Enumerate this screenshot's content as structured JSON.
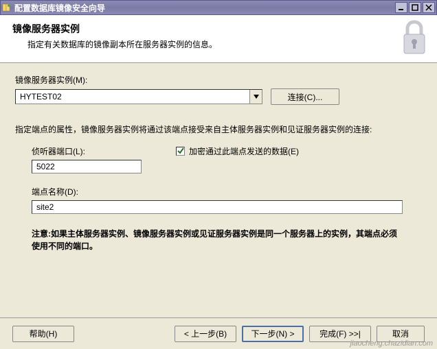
{
  "titlebar": {
    "title": "配置数据库镜像安全向导"
  },
  "header": {
    "title": "镜像服务器实例",
    "subtitle": "指定有关数据库的镜像副本所在服务器实例的信息。"
  },
  "mirror_server": {
    "label": "镜像服务器实例(M):",
    "value": "HYTEST02",
    "connect_button": "连接(C)..."
  },
  "endpoint_desc": "指定端点的属性，镜像服务器实例将通过该端点接受来自主体服务器实例和见证服务器实例的连接:",
  "listener_port": {
    "label": "侦听器端口(L):",
    "value": "5022"
  },
  "encrypt": {
    "checked": true,
    "label": "加密通过此端点发送的数据(E)"
  },
  "endpoint_name": {
    "label": "端点名称(D):",
    "value": "site2"
  },
  "warning": "注意:如果主体服务器实例、镜像服务器实例或见证服务器实例是同一个服务器上的实例，其端点必须使用不同的端口。",
  "buttons": {
    "help": "帮助(H)",
    "back": "< 上一步(B)",
    "next": "下一步(N) >",
    "finish": "完成(F) >>|",
    "cancel": "取消"
  },
  "watermark": "jiaocheng.chazidian.com"
}
